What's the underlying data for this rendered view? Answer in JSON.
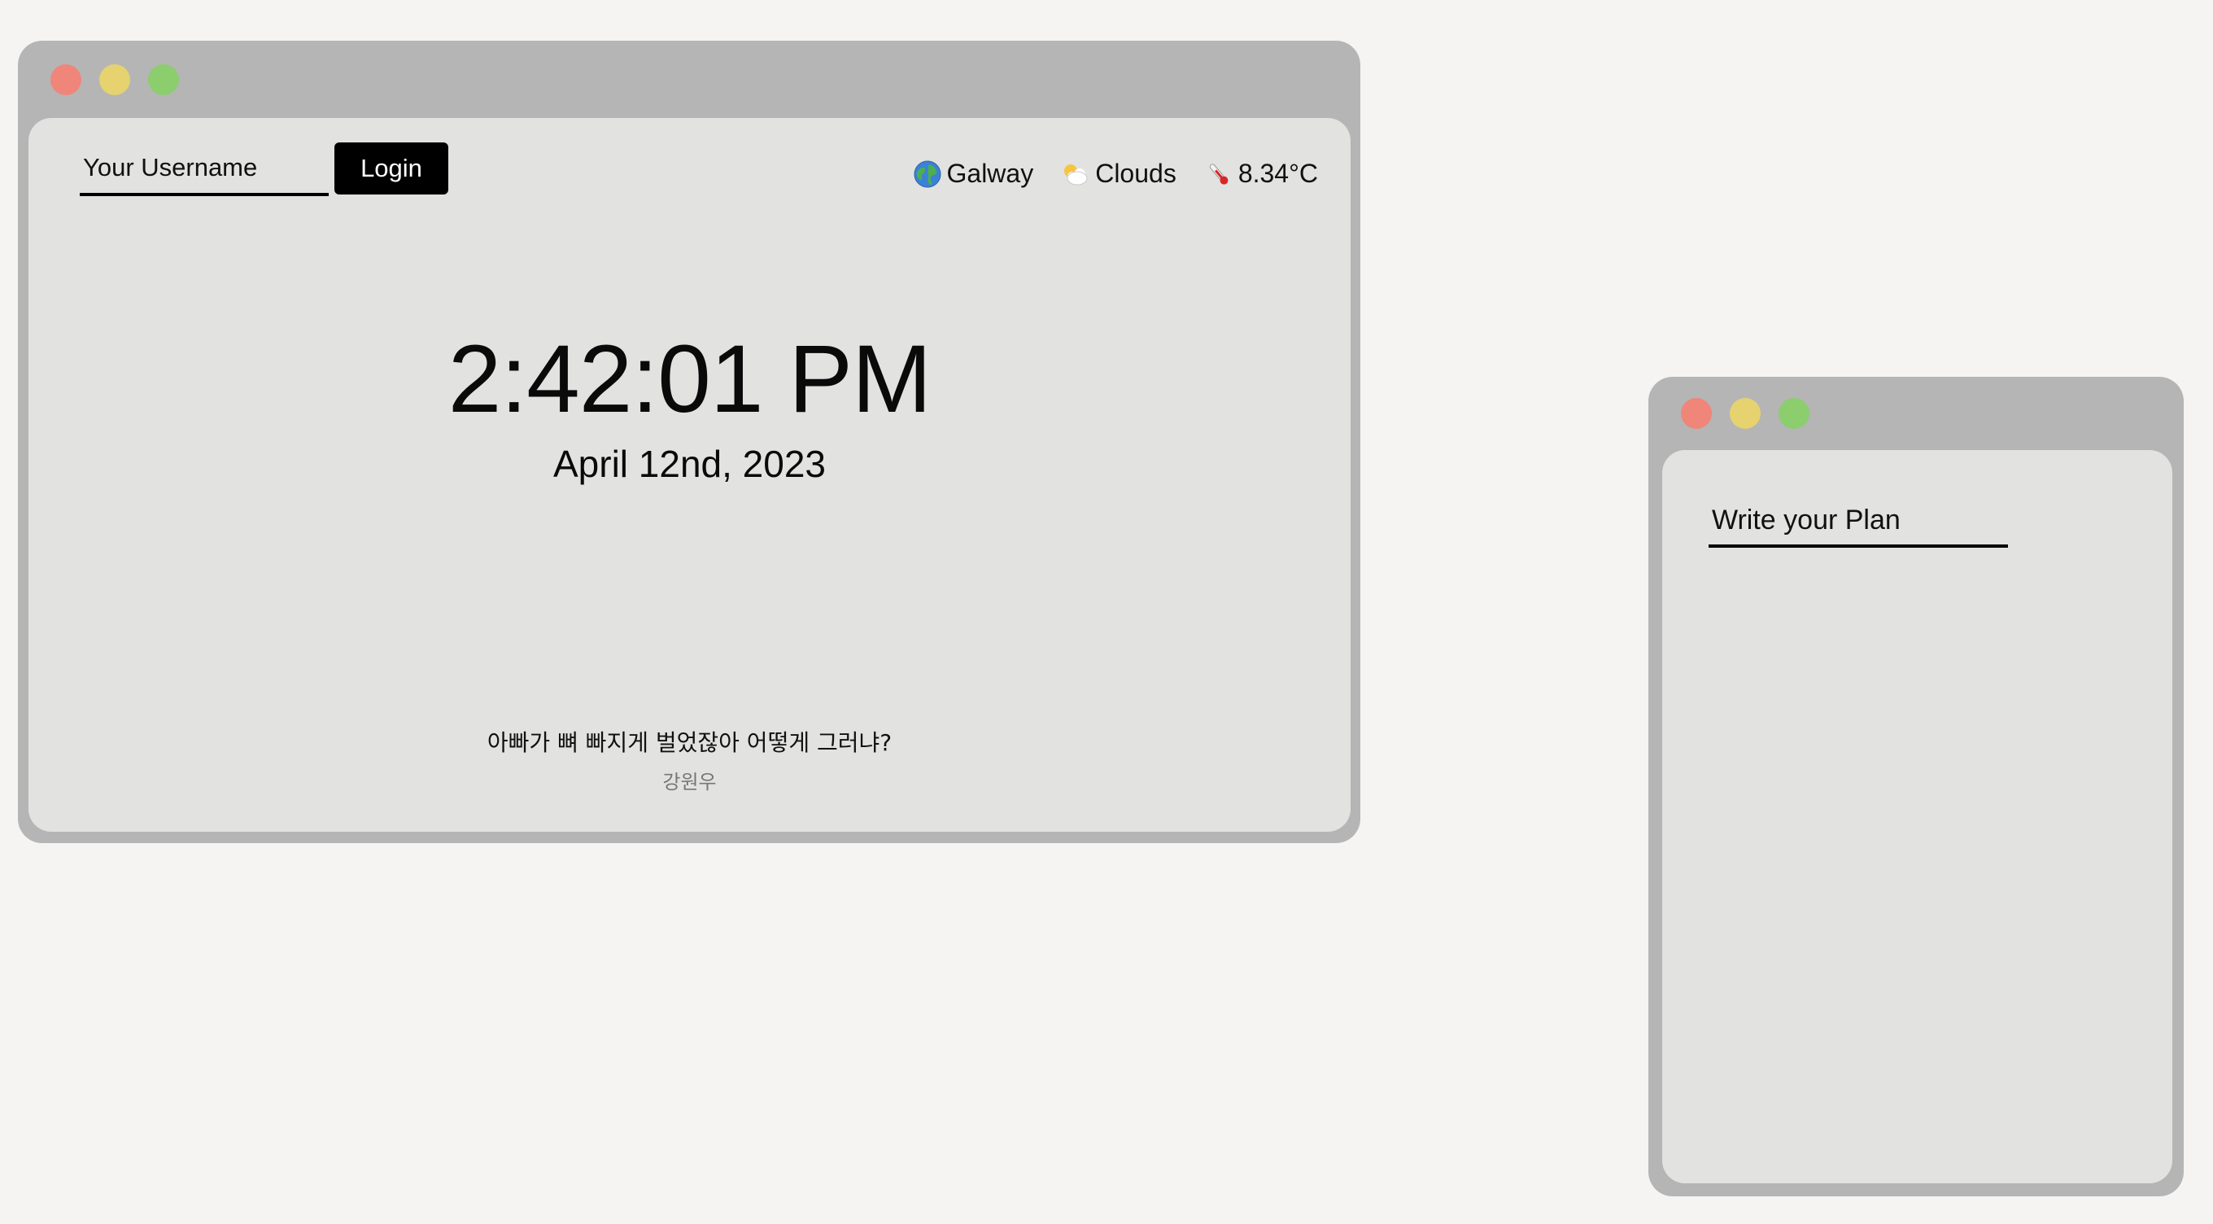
{
  "login": {
    "username_placeholder": "Your Username",
    "button_label": "Login"
  },
  "weather": {
    "city": "Galway",
    "city_icon": "globe-icon",
    "condition": "Clouds",
    "condition_icon": "cloud-sun-icon",
    "temperature": "8.34°C",
    "temperature_icon": "thermometer-icon"
  },
  "clock": {
    "time": "2:42:01 PM",
    "date": "April 12nd, 2023"
  },
  "quote": {
    "text": "아빠가 뼈 빠지게 벌었잖아 어떻게 그러냐?",
    "author": "강원우"
  },
  "plan": {
    "placeholder": "Write your Plan"
  },
  "colors": {
    "background": "#f5f4f2",
    "window_frame": "#b5b5b5",
    "window_content": "#e2e2e1",
    "traffic_red": "#f0857a",
    "traffic_yellow": "#e6d26e",
    "traffic_green": "#8ccd6e",
    "button": "#000000"
  }
}
